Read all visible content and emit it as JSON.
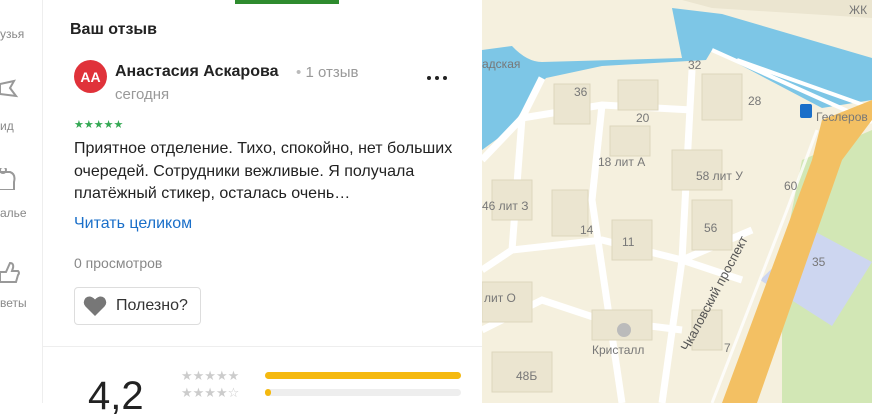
{
  "sidebar": {
    "items": [
      {
        "label": "узья",
        "icon": "friends-icon"
      },
      {
        "label": "ид",
        "icon": "pin-icon"
      },
      {
        "label": "алье",
        "icon": "gallery-icon"
      },
      {
        "label": "веты",
        "icon": "thumbs-up-icon"
      }
    ]
  },
  "review": {
    "section_title": "Ваш отзыв",
    "avatar_initials": "АА",
    "author": "Анастасия Аскарова",
    "review_count": "1 отзыв",
    "date": "сегодня",
    "stars": 5,
    "text": "Приятное отделение. Тихо, спокойно, нет больших очередей. Сотрудники вежливые. Я получала платёжный стикер, осталась очень…",
    "read_more": "Читать целиком",
    "views": "0 просмотров",
    "useful_label": "Полезно?"
  },
  "rating": {
    "value": "4,2",
    "distribution": [
      {
        "stars": 5,
        "fill": 1.0
      },
      {
        "stars": 4,
        "fill": 0.03
      }
    ]
  },
  "map": {
    "labels": {
      "zhk": "ЖК",
      "gesler": "Геслеров",
      "street_adskaya": "адская",
      "b36": "36",
      "b32": "32",
      "b28": "28",
      "b20": "20",
      "b18": "18 лит А",
      "b58": "58 лит У",
      "b60": "60",
      "b46": "46 лит З",
      "b14": "14",
      "b56": "56",
      "b11": "11",
      "b35": "35",
      "blitO": "лит О",
      "chkalovsky": "Чкаловский проспект",
      "kristall": "Кристалл",
      "b48b": "48Б",
      "b7": "7"
    },
    "colors": {
      "water": "#7dc6e6",
      "block": "#f5f0de",
      "building": "#ebe5d0",
      "road": "#ffffff",
      "avenue": "#f3c063",
      "park": "#d2e7b5",
      "metro": "#1a6fc9"
    }
  }
}
